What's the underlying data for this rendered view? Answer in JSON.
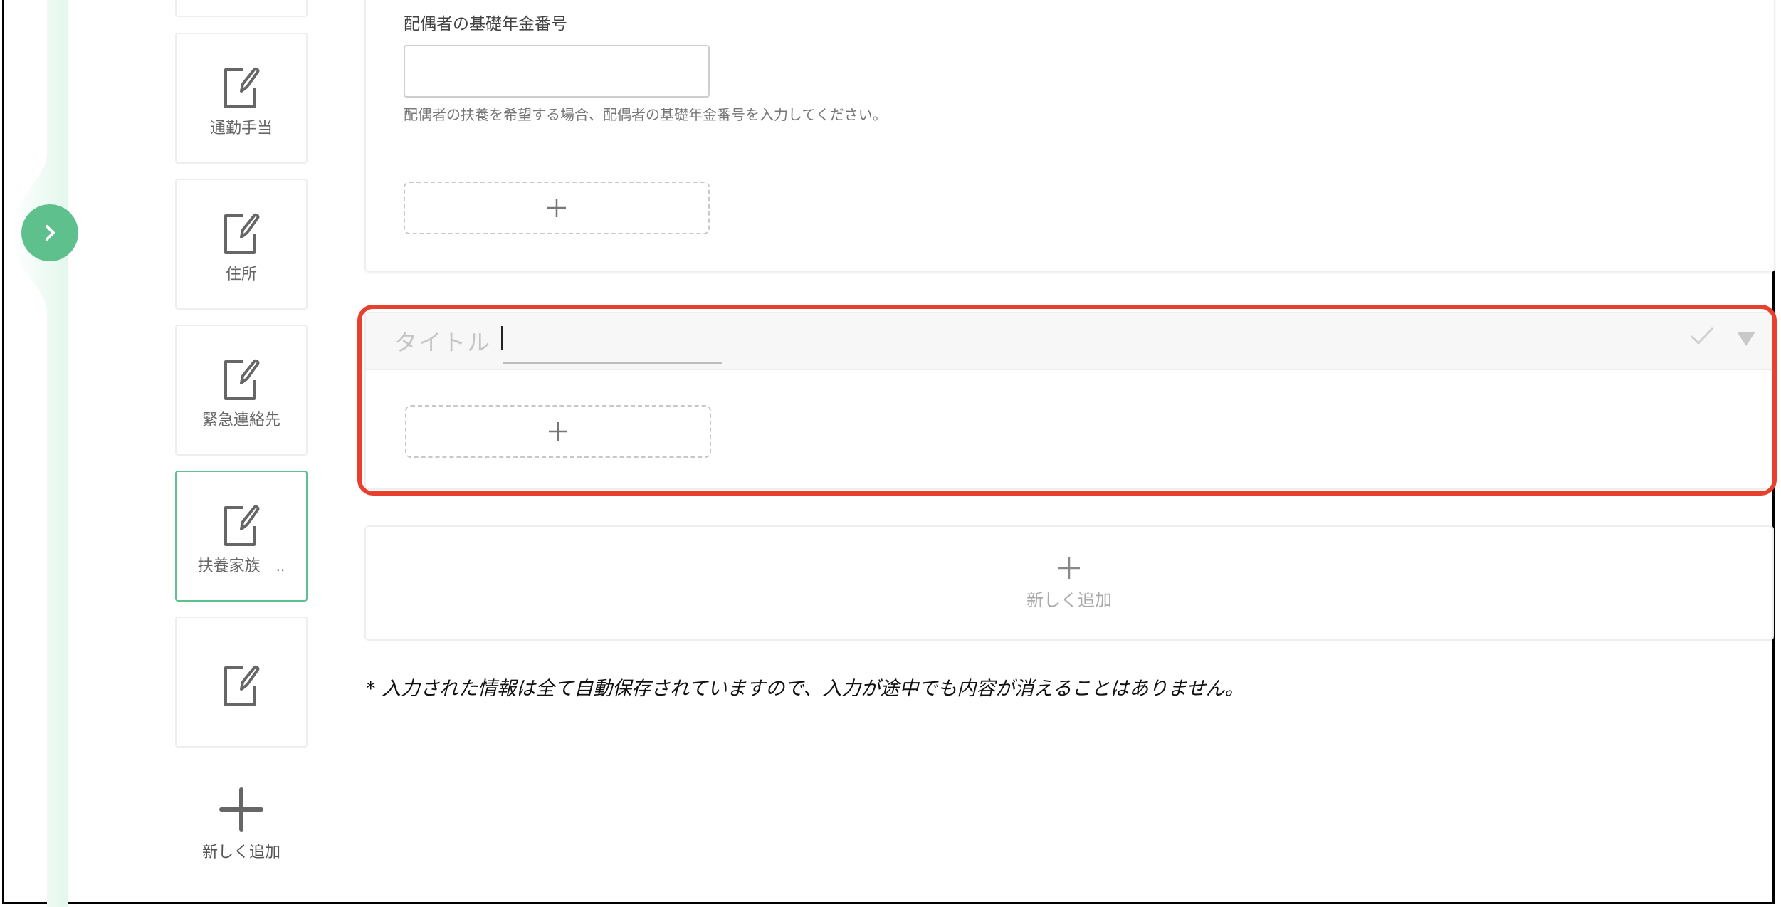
{
  "sidebar": {
    "items": [
      {
        "label": "通勤手当",
        "icon": "edit-icon"
      },
      {
        "label": "住所",
        "icon": "edit-icon"
      },
      {
        "label": "緊急連絡先",
        "icon": "edit-icon"
      },
      {
        "label": "扶養家族",
        "suffix": "..",
        "icon": "edit-icon",
        "active": true
      },
      {
        "label": "",
        "icon": "edit-icon"
      }
    ],
    "add_label": "新しく追加"
  },
  "form": {
    "field_label": "配偶者の基礎年金番号",
    "field_value": "",
    "help_text": "配偶者の扶養を希望する場合、配偶者の基礎年金番号を入力してください。"
  },
  "new_section": {
    "title_placeholder": "タイトル",
    "title_value": ""
  },
  "add_section_label": "新しく追加",
  "autosave_note": "* 入力された情報は全て自動保存されていますので、入力が途中でも内容が消えることはありません。",
  "colors": {
    "accent": "#5ec08c",
    "highlight": "#e8402c",
    "border": "#eeeeee"
  }
}
